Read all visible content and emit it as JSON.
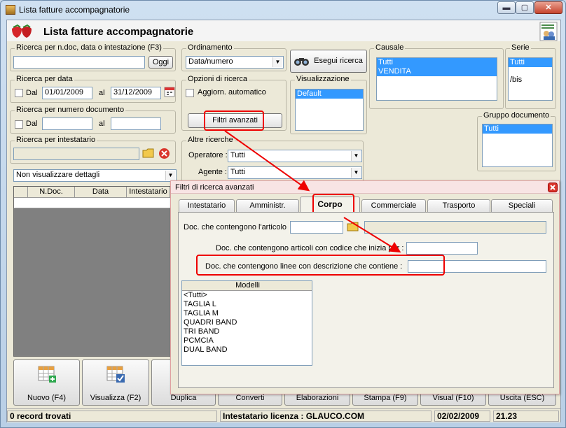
{
  "window": {
    "title": "Lista fatture accompagnatorie",
    "min_glyph": "▬",
    "max_glyph": "▢",
    "close_glyph": "✕"
  },
  "header": {
    "title": "Lista fatture accompagnatorie"
  },
  "search_text": {
    "label": "Ricerca per n.doc, data o intestazione (F3)",
    "value": "",
    "today_button": "Oggi"
  },
  "sort": {
    "label": "Ordinamento",
    "selected": "Data/numero"
  },
  "run_search": {
    "label": "Esegui ricerca"
  },
  "causale": {
    "label": "Causale",
    "items": [
      "Tutti",
      "VENDITA"
    ]
  },
  "serie": {
    "label": "Serie",
    "items": [
      "Tutti",
      "/bis"
    ]
  },
  "date_search": {
    "label": "Ricerca per data",
    "from_label": "Dal",
    "from_value": "01/01/2009",
    "to_label": "al",
    "to_value": "31/12/2009"
  },
  "search_options": {
    "label": "Opzioni di ricerca",
    "auto_update_label": "Aggiorn. automatico",
    "advanced_button": "Filtri avanzati"
  },
  "view": {
    "label": "Visualizzazione",
    "items": [
      "Default"
    ]
  },
  "number_search": {
    "label": "Ricerca per numero documento",
    "from_label": "Dal",
    "to_label": "al"
  },
  "doc_group": {
    "label": "Gruppo documento",
    "items": [
      "Tutti"
    ]
  },
  "holder_search": {
    "label": "Ricerca per intestatario",
    "value": ""
  },
  "other_search": {
    "label": "Altre ricerche",
    "operator_label": "Operatore :",
    "operator_value": "Tutti",
    "agent_label": "Agente :",
    "agent_value": "Tutti"
  },
  "details": {
    "selected": "Non visualizzare dettagli"
  },
  "grid": {
    "columns": [
      "",
      "N.Doc.",
      "Data",
      "Intestatario"
    ]
  },
  "actions": {
    "new": "Nuovo (F4)",
    "view": "Visualizza (F2)",
    "duplicate": "Duplica",
    "convert": "Converti",
    "process": "Elaborazioni",
    "print": "Stampa (F9)",
    "visual": "Visual (F10)",
    "exit": "Uscita (ESC)"
  },
  "status": {
    "records": "0 record trovati",
    "license": "Intestatario licenza : GLAUCO.COM",
    "date": "02/02/2009",
    "time": "21.23"
  },
  "popup": {
    "title": "Filtri di ricerca avanzati",
    "tabs": [
      "Intestatario",
      "Amministr.",
      "Corpo",
      "Commerciale",
      "Trasporto",
      "Speciali"
    ],
    "active_tab": "Corpo",
    "article_label": "Doc. che contengono l'articolo",
    "code_prefix_label": "Doc. che contengono articoli con codice che inizia per :",
    "description_label": "Doc. che contengono linee con descrizione che contiene :",
    "models": {
      "header": "Modelli",
      "items": [
        "<Tutti>",
        "TAGLIA L",
        "TAGLIA M",
        "QUADRI BAND",
        "TRI BAND",
        "PCMCIA",
        "DUAL BAND"
      ]
    }
  }
}
